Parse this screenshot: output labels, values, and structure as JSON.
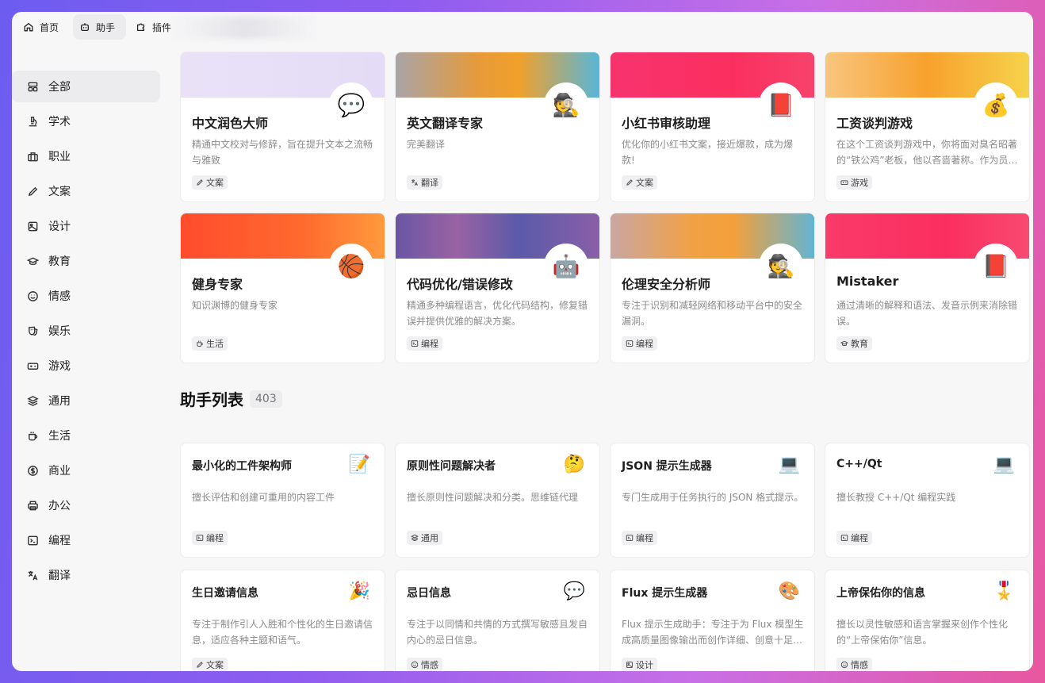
{
  "tabs": [
    {
      "label": "首页",
      "icon": "home-icon",
      "active": false
    },
    {
      "label": "助手",
      "icon": "robot-icon",
      "active": true
    },
    {
      "label": "插件",
      "icon": "puzzle-icon",
      "active": false
    }
  ],
  "sidebar": {
    "items": [
      {
        "label": "全部",
        "icon": "grid-icon",
        "active": true
      },
      {
        "label": "学术",
        "icon": "microscope-icon"
      },
      {
        "label": "职业",
        "icon": "briefcase-icon"
      },
      {
        "label": "文案",
        "icon": "pencil-icon"
      },
      {
        "label": "设计",
        "icon": "image-icon"
      },
      {
        "label": "教育",
        "icon": "graduation-cap-icon"
      },
      {
        "label": "情感",
        "icon": "smile-icon"
      },
      {
        "label": "娱乐",
        "icon": "theater-mask-icon"
      },
      {
        "label": "游戏",
        "icon": "gamepad-icon"
      },
      {
        "label": "通用",
        "icon": "layers-icon"
      },
      {
        "label": "生活",
        "icon": "coffee-cup-icon"
      },
      {
        "label": "商业",
        "icon": "dollar-circle-icon"
      },
      {
        "label": "办公",
        "icon": "printer-icon"
      },
      {
        "label": "编程",
        "icon": "terminal-icon"
      },
      {
        "label": "翻译",
        "icon": "translate-icon"
      }
    ]
  },
  "featured": [
    {
      "title": "中文润色大师",
      "desc": "精通中文校对与修辞，旨在提升文本之流畅与雅致",
      "tag": "文案",
      "tag_icon": "pencil-icon",
      "emoji": "💬",
      "banner": "linear-gradient(90deg,#e9e2f7,#e4dcf6)"
    },
    {
      "title": "英文翻译专家",
      "desc": "完美翻译",
      "tag": "翻译",
      "tag_icon": "translate-icon",
      "emoji": "🕵️",
      "banner": "linear-gradient(90deg,#a9a4a8,#e59a3b 40%,#f2a02a 60%,#58b6d8)"
    },
    {
      "title": "小红书审核助理",
      "desc": "优化你的小红书文案，接近爆款，成为爆款!",
      "tag": "文案",
      "tag_icon": "pencil-icon",
      "emoji": "📕",
      "banner": "linear-gradient(90deg,#f7336e,#fb2f5f 60%,#f7436b)"
    },
    {
      "title": "工资谈判游戏",
      "desc": "在这个工资谈判游戏中，你将面对臭名昭著的“铁公鸡”老板，他以吝啬著称。作为员工，你的任务是说服他给你加薪。",
      "tag": "游戏",
      "tag_icon": "gamepad-icon",
      "emoji": "💰",
      "banner": "linear-gradient(90deg,#f8c57f,#f7a12d 50%,#f6d34a)"
    },
    {
      "title": "健身专家",
      "desc": "知识渊博的健身专家",
      "tag": "生活",
      "tag_icon": "coffee-cup-icon",
      "emoji": "🏀",
      "banner": "linear-gradient(90deg,#ff4c2d,#ff6a2e 60%,#ff9a3c)"
    },
    {
      "title": "代码优化/错误修改",
      "desc": "精通多种编程语言，优化代码结构，修复错误并提供优雅的解决方案。",
      "tag": "编程",
      "tag_icon": "terminal-icon",
      "emoji": "🤖",
      "banner": "linear-gradient(90deg,#6a56a4,#9a63a3 30%,#5b5aa9 60%,#8a5fa7)"
    },
    {
      "title": "伦理安全分析师",
      "desc": "专注于识别和减轻网络和移动平台中的安全漏洞。",
      "tag": "编程",
      "tag_icon": "terminal-icon",
      "emoji": "🕵️",
      "banner": "linear-gradient(90deg,#c9a7a2,#f1a145 40%,#f4a03a 60%,#62b5d3)"
    },
    {
      "title": "Mistaker",
      "desc": "通过清晰的解释和语法、发音示例来消除错误。",
      "tag": "教育",
      "tag_icon": "graduation-cap-icon",
      "emoji": "📕",
      "banner": "linear-gradient(90deg,#f93a6a,#fb2f5f 60%,#f84a72)"
    }
  ],
  "list": {
    "title": "助手列表",
    "count": "403",
    "items": [
      {
        "title": "最小化的工件架构师",
        "desc": "擅长评估和创建可重用的内容工件",
        "tag": "编程",
        "tag_icon": "terminal-icon",
        "emoji": "📝"
      },
      {
        "title": "原则性问题解决者",
        "desc": "擅长原则性问题解决和分类。思维链代理",
        "tag": "通用",
        "tag_icon": "layers-icon",
        "emoji": "🤔"
      },
      {
        "title": "JSON 提示生成器",
        "desc": "专门生成用于任务执行的 JSON 格式提示。",
        "tag": "编程",
        "tag_icon": "terminal-icon",
        "emoji": "💻"
      },
      {
        "title": "C++/Qt",
        "desc": "擅长教授 C++/Qt 编程实践",
        "tag": "编程",
        "tag_icon": "terminal-icon",
        "emoji": "💻"
      },
      {
        "title": "生日邀请信息",
        "desc": "专注于制作引人入胜和个性化的生日邀请信息，适应各种主题和语气。",
        "tag": "文案",
        "tag_icon": "pencil-icon",
        "emoji": "🎉"
      },
      {
        "title": "忌日信息",
        "desc": "专注于以同情和共情的方式撰写敏感且发自内心的忌日信息。",
        "tag": "情感",
        "tag_icon": "smile-icon",
        "emoji": "💬"
      },
      {
        "title": "Flux 提示生成器",
        "desc": "Flux 提示生成助手：专注于为 Flux 模型生成高质量图像输出而创作详细、创意十足的提示。",
        "tag": "设计",
        "tag_icon": "image-icon",
        "emoji": "🎨"
      },
      {
        "title": "上帝保佑你的信息",
        "desc": "擅长以灵性敏感和语言掌握来创作个性化的“上帝保佑你”信息。",
        "tag": "情感",
        "tag_icon": "smile-icon",
        "emoji": "🎖️"
      }
    ]
  }
}
